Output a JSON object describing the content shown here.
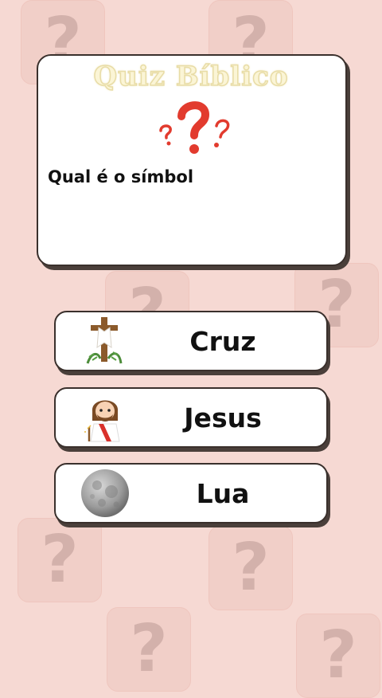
{
  "header": {
    "title": "Quiz Bíblico"
  },
  "question": {
    "text": "Qual é o símbol"
  },
  "background": {
    "glyph": "?"
  },
  "options": [
    {
      "label": "Cruz",
      "icon": "cross-icon"
    },
    {
      "label": "Jesus",
      "icon": "jesus-icon"
    },
    {
      "label": "Lua",
      "icon": "moon-icon"
    }
  ],
  "colors": {
    "background": "#f6d9d3",
    "accent_red": "#e23b2e",
    "title_fill": "#fbf5d6"
  }
}
